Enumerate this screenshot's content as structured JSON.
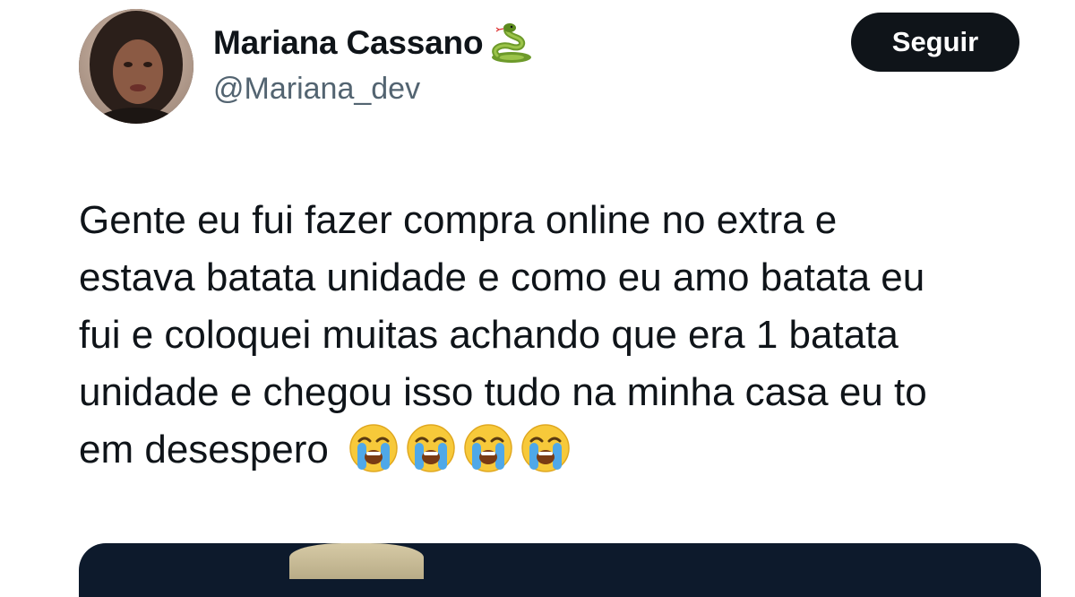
{
  "author": {
    "display_name": "Mariana Cassano",
    "display_name_emoji": "snake-emoji",
    "handle": "@Mariana_dev",
    "avatar_icon": "profile-photo"
  },
  "follow_button": {
    "label": "Seguir",
    "background": "#0f1419",
    "text_color": "#ffffff"
  },
  "tweet": {
    "text_lines": [
      "Gente eu fui fazer compra online no extra e",
      "estava batata unidade e como eu amo batata eu",
      "fui e coloquei muitas achando que era 1 batata",
      "unidade e chegou isso tudo na minha casa eu to",
      "em desespero"
    ],
    "emojis": [
      "loudly-crying-face",
      "loudly-crying-face",
      "loudly-crying-face",
      "loudly-crying-face"
    ]
  },
  "colors": {
    "text_primary": "#0f1419",
    "text_secondary": "#536471",
    "media_bg": "#0d1a2c"
  }
}
